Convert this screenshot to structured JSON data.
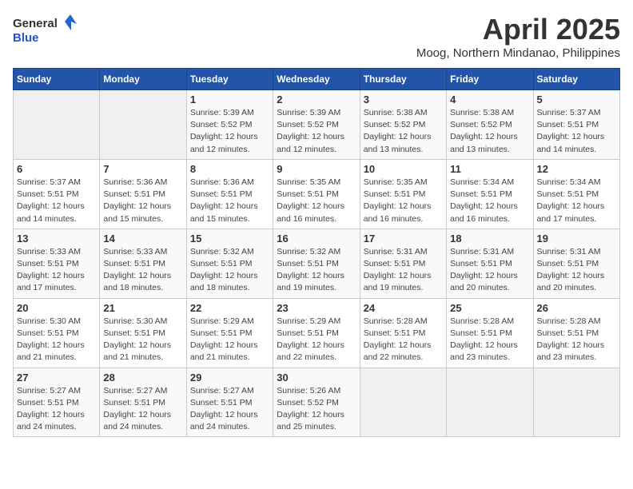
{
  "header": {
    "logo_general": "General",
    "logo_blue": "Blue",
    "title": "April 2025",
    "subtitle": "Moog, Northern Mindanao, Philippines"
  },
  "weekdays": [
    "Sunday",
    "Monday",
    "Tuesday",
    "Wednesday",
    "Thursday",
    "Friday",
    "Saturday"
  ],
  "weeks": [
    [
      {
        "day": "",
        "sunrise": "",
        "sunset": "",
        "daylight": ""
      },
      {
        "day": "",
        "sunrise": "",
        "sunset": "",
        "daylight": ""
      },
      {
        "day": "1",
        "sunrise": "Sunrise: 5:39 AM",
        "sunset": "Sunset: 5:52 PM",
        "daylight": "Daylight: 12 hours and 12 minutes."
      },
      {
        "day": "2",
        "sunrise": "Sunrise: 5:39 AM",
        "sunset": "Sunset: 5:52 PM",
        "daylight": "Daylight: 12 hours and 12 minutes."
      },
      {
        "day": "3",
        "sunrise": "Sunrise: 5:38 AM",
        "sunset": "Sunset: 5:52 PM",
        "daylight": "Daylight: 12 hours and 13 minutes."
      },
      {
        "day": "4",
        "sunrise": "Sunrise: 5:38 AM",
        "sunset": "Sunset: 5:52 PM",
        "daylight": "Daylight: 12 hours and 13 minutes."
      },
      {
        "day": "5",
        "sunrise": "Sunrise: 5:37 AM",
        "sunset": "Sunset: 5:51 PM",
        "daylight": "Daylight: 12 hours and 14 minutes."
      }
    ],
    [
      {
        "day": "6",
        "sunrise": "Sunrise: 5:37 AM",
        "sunset": "Sunset: 5:51 PM",
        "daylight": "Daylight: 12 hours and 14 minutes."
      },
      {
        "day": "7",
        "sunrise": "Sunrise: 5:36 AM",
        "sunset": "Sunset: 5:51 PM",
        "daylight": "Daylight: 12 hours and 15 minutes."
      },
      {
        "day": "8",
        "sunrise": "Sunrise: 5:36 AM",
        "sunset": "Sunset: 5:51 PM",
        "daylight": "Daylight: 12 hours and 15 minutes."
      },
      {
        "day": "9",
        "sunrise": "Sunrise: 5:35 AM",
        "sunset": "Sunset: 5:51 PM",
        "daylight": "Daylight: 12 hours and 16 minutes."
      },
      {
        "day": "10",
        "sunrise": "Sunrise: 5:35 AM",
        "sunset": "Sunset: 5:51 PM",
        "daylight": "Daylight: 12 hours and 16 minutes."
      },
      {
        "day": "11",
        "sunrise": "Sunrise: 5:34 AM",
        "sunset": "Sunset: 5:51 PM",
        "daylight": "Daylight: 12 hours and 16 minutes."
      },
      {
        "day": "12",
        "sunrise": "Sunrise: 5:34 AM",
        "sunset": "Sunset: 5:51 PM",
        "daylight": "Daylight: 12 hours and 17 minutes."
      }
    ],
    [
      {
        "day": "13",
        "sunrise": "Sunrise: 5:33 AM",
        "sunset": "Sunset: 5:51 PM",
        "daylight": "Daylight: 12 hours and 17 minutes."
      },
      {
        "day": "14",
        "sunrise": "Sunrise: 5:33 AM",
        "sunset": "Sunset: 5:51 PM",
        "daylight": "Daylight: 12 hours and 18 minutes."
      },
      {
        "day": "15",
        "sunrise": "Sunrise: 5:32 AM",
        "sunset": "Sunset: 5:51 PM",
        "daylight": "Daylight: 12 hours and 18 minutes."
      },
      {
        "day": "16",
        "sunrise": "Sunrise: 5:32 AM",
        "sunset": "Sunset: 5:51 PM",
        "daylight": "Daylight: 12 hours and 19 minutes."
      },
      {
        "day": "17",
        "sunrise": "Sunrise: 5:31 AM",
        "sunset": "Sunset: 5:51 PM",
        "daylight": "Daylight: 12 hours and 19 minutes."
      },
      {
        "day": "18",
        "sunrise": "Sunrise: 5:31 AM",
        "sunset": "Sunset: 5:51 PM",
        "daylight": "Daylight: 12 hours and 20 minutes."
      },
      {
        "day": "19",
        "sunrise": "Sunrise: 5:31 AM",
        "sunset": "Sunset: 5:51 PM",
        "daylight": "Daylight: 12 hours and 20 minutes."
      }
    ],
    [
      {
        "day": "20",
        "sunrise": "Sunrise: 5:30 AM",
        "sunset": "Sunset: 5:51 PM",
        "daylight": "Daylight: 12 hours and 21 minutes."
      },
      {
        "day": "21",
        "sunrise": "Sunrise: 5:30 AM",
        "sunset": "Sunset: 5:51 PM",
        "daylight": "Daylight: 12 hours and 21 minutes."
      },
      {
        "day": "22",
        "sunrise": "Sunrise: 5:29 AM",
        "sunset": "Sunset: 5:51 PM",
        "daylight": "Daylight: 12 hours and 21 minutes."
      },
      {
        "day": "23",
        "sunrise": "Sunrise: 5:29 AM",
        "sunset": "Sunset: 5:51 PM",
        "daylight": "Daylight: 12 hours and 22 minutes."
      },
      {
        "day": "24",
        "sunrise": "Sunrise: 5:28 AM",
        "sunset": "Sunset: 5:51 PM",
        "daylight": "Daylight: 12 hours and 22 minutes."
      },
      {
        "day": "25",
        "sunrise": "Sunrise: 5:28 AM",
        "sunset": "Sunset: 5:51 PM",
        "daylight": "Daylight: 12 hours and 23 minutes."
      },
      {
        "day": "26",
        "sunrise": "Sunrise: 5:28 AM",
        "sunset": "Sunset: 5:51 PM",
        "daylight": "Daylight: 12 hours and 23 minutes."
      }
    ],
    [
      {
        "day": "27",
        "sunrise": "Sunrise: 5:27 AM",
        "sunset": "Sunset: 5:51 PM",
        "daylight": "Daylight: 12 hours and 24 minutes."
      },
      {
        "day": "28",
        "sunrise": "Sunrise: 5:27 AM",
        "sunset": "Sunset: 5:51 PM",
        "daylight": "Daylight: 12 hours and 24 minutes."
      },
      {
        "day": "29",
        "sunrise": "Sunrise: 5:27 AM",
        "sunset": "Sunset: 5:51 PM",
        "daylight": "Daylight: 12 hours and 24 minutes."
      },
      {
        "day": "30",
        "sunrise": "Sunrise: 5:26 AM",
        "sunset": "Sunset: 5:52 PM",
        "daylight": "Daylight: 12 hours and 25 minutes."
      },
      {
        "day": "",
        "sunrise": "",
        "sunset": "",
        "daylight": ""
      },
      {
        "day": "",
        "sunrise": "",
        "sunset": "",
        "daylight": ""
      },
      {
        "day": "",
        "sunrise": "",
        "sunset": "",
        "daylight": ""
      }
    ]
  ]
}
